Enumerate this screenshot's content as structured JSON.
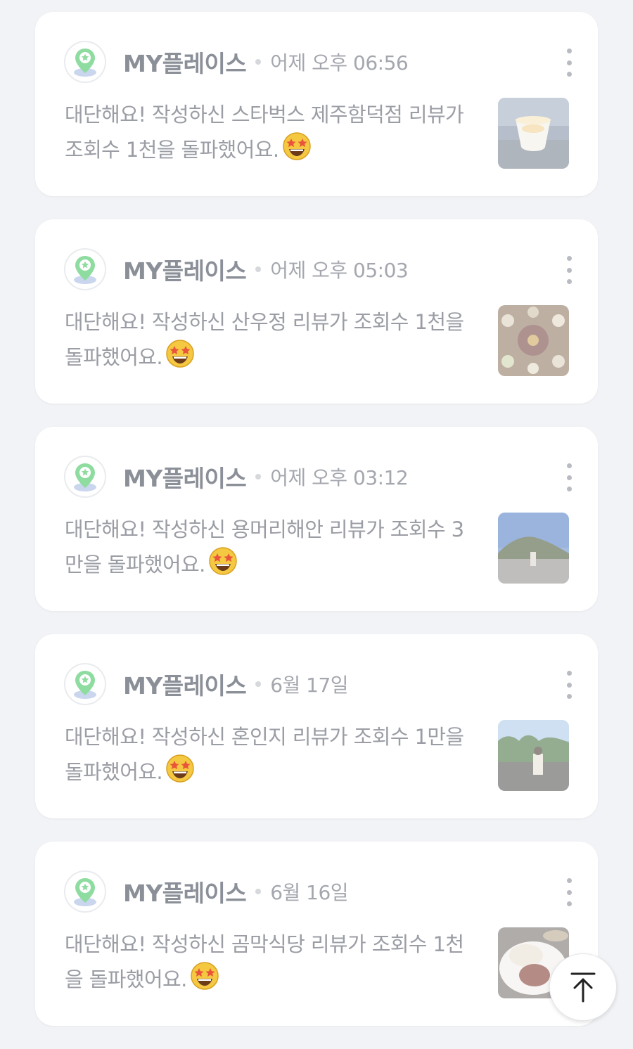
{
  "feed": {
    "items": [
      {
        "source": "MY플레이스",
        "time": "어제 오후 06:56",
        "message": "대단해요! 작성하신 스타벅스 제주함덕점 리뷰가 조회수 1천을 돌파했어요.",
        "emoji": "star-struck-emoji",
        "thumbnail": "dessert-cup-photo"
      },
      {
        "source": "MY플레이스",
        "time": "어제 오후 05:03",
        "message": "대단해요! 작성하신 산우정 리뷰가 조회수 1천을 돌파했어요.",
        "emoji": "star-struck-emoji",
        "thumbnail": "table-dishes-photo"
      },
      {
        "source": "MY플레이스",
        "time": "어제 오후 03:12",
        "message": "대단해요! 작성하신 용머리해안 리뷰가 조회수 3만을 돌파했어요.",
        "emoji": "star-struck-emoji",
        "thumbnail": "coastal-hill-photo"
      },
      {
        "source": "MY플레이스",
        "time": "6월 17일",
        "message": "대단해요! 작성하신 혼인지 리뷰가 조회수 1만을 돌파했어요.",
        "emoji": "star-struck-emoji",
        "thumbnail": "stone-wall-garden-photo"
      },
      {
        "source": "MY플레이스",
        "time": "6월 16일",
        "message": "대단해요! 작성하신 곰막식당 리뷰가 조회수 1천을 돌파했어요.",
        "emoji": "star-struck-emoji",
        "thumbnail": "noodle-dish-photo"
      }
    ]
  },
  "icons": {
    "app_avatar": "map-pin-star-icon",
    "more": "more-vertical-icon",
    "scroll_top": "arrow-up-to-top-icon"
  },
  "colors": {
    "background": "#f2f3f6",
    "card": "#ffffff",
    "accent_green": "#6fd38a",
    "text_muted": "#9a9da4"
  }
}
